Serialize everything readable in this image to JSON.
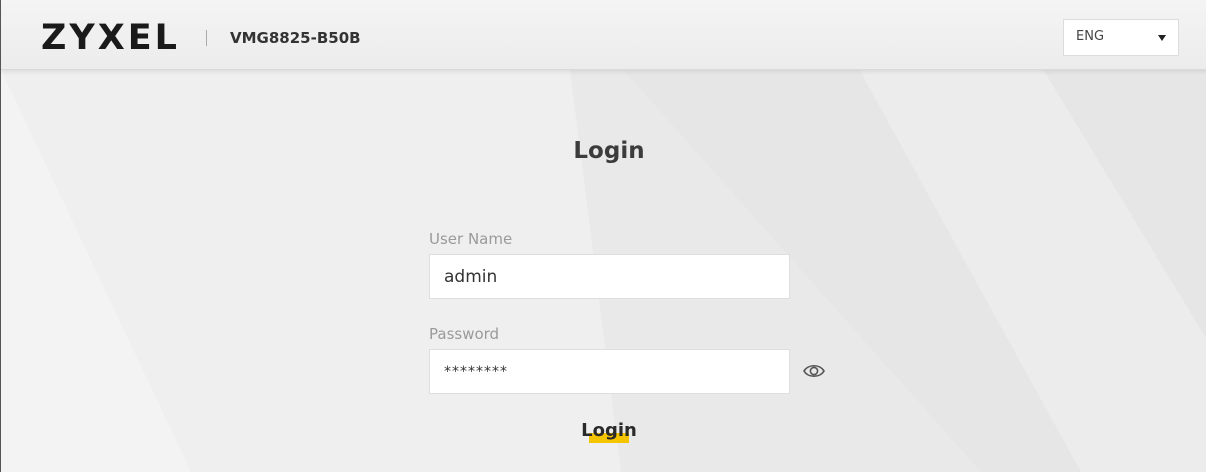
{
  "header": {
    "brand": "ZYXEL",
    "model": "VMG8825-B50B",
    "language": {
      "selected": "ENG",
      "caret_icon": "chevron-down-icon"
    }
  },
  "login_form": {
    "title": "Login",
    "username": {
      "label": "User Name",
      "value": "admin"
    },
    "password": {
      "label": "Password",
      "value": "********",
      "toggle_icon": "eye-icon"
    },
    "submit_label": "Login"
  },
  "colors": {
    "accent": "#f5c400",
    "background": "#e9e9e9",
    "header_background": "#f2f2f2"
  }
}
